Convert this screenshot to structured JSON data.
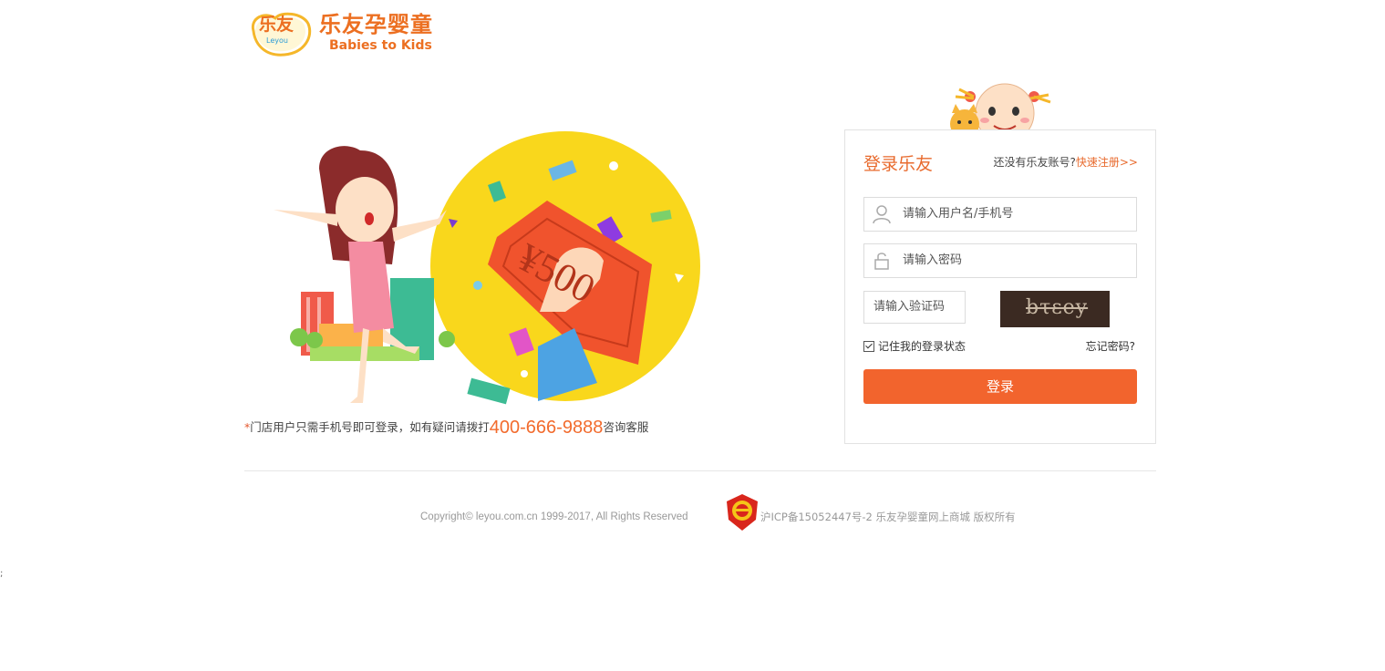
{
  "header": {
    "logo_badge": "乐友",
    "logo_badge_small": "Leyou",
    "brand_name": "乐友孕婴童",
    "brand_slogan": "Babies to Kids"
  },
  "hero": {
    "coupon_text": "¥500",
    "notice_prefix": "*",
    "notice_text": "门店用户只需手机号即可登录，如有疑问请拨打",
    "phone": "400-666-9888",
    "notice_suffix": "咨询客服"
  },
  "login": {
    "title": "登录乐友",
    "no_account_text": "还没有乐友账号?",
    "register_link": "快速注册>>",
    "username_placeholder": "请输入用户名/手机号",
    "password_placeholder": "请输入密码",
    "captcha_placeholder": "请输入验证码",
    "captcha_text": "bτεey",
    "remember_label": "记住我的登录状态",
    "remember_checked": true,
    "forgot_link": "忘记密码?",
    "submit_label": "登录"
  },
  "footer": {
    "copyright": "Copyright© leyou.com.cn 1999-2017, All Rights Reserved",
    "icp": "沪ICP备15052447号-2 乐友孕婴童网上商城 版权所有"
  },
  "stray_text": ";",
  "colors": {
    "accent": "#f2642d",
    "title_orange": "#e86a2d",
    "yellow_circle": "#f9d71c",
    "red_envelope": "#f0532d"
  }
}
